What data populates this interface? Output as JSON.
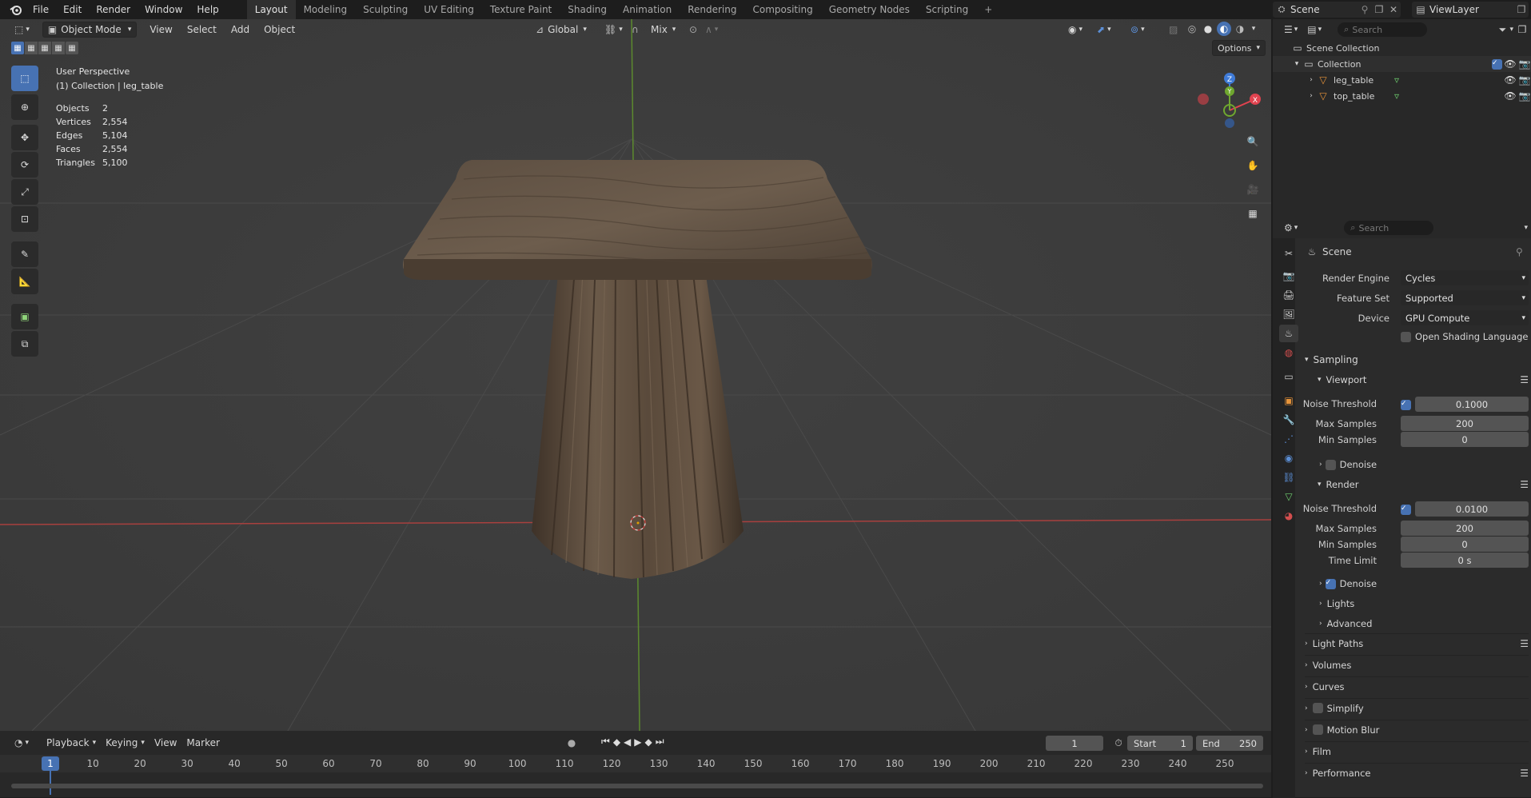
{
  "topbar": {
    "menus": [
      "File",
      "Edit",
      "Render",
      "Window",
      "Help"
    ],
    "workspaces": [
      "Layout",
      "Modeling",
      "Sculpting",
      "UV Editing",
      "Texture Paint",
      "Shading",
      "Animation",
      "Rendering",
      "Compositing",
      "Geometry Nodes",
      "Scripting"
    ],
    "active_workspace": "Layout",
    "scene_name": "Scene",
    "view_layer": "ViewLayer"
  },
  "viewport": {
    "mode": "Object Mode",
    "menus": [
      "View",
      "Select",
      "Add",
      "Object"
    ],
    "orientation": "Global",
    "snap_mix": "Mix",
    "options_label": "Options",
    "overlay_title": "User Perspective",
    "overlay_collection": "(1) Collection | leg_table",
    "stats": [
      {
        "label": "Objects",
        "value": "2"
      },
      {
        "label": "Vertices",
        "value": "2,554"
      },
      {
        "label": "Edges",
        "value": "5,104"
      },
      {
        "label": "Faces",
        "value": "2,554"
      },
      {
        "label": "Triangles",
        "value": "5,100"
      }
    ],
    "gizmo": {
      "x": "X",
      "y": "Y",
      "z": "Z",
      "x_color": "#e0434f",
      "y_color": "#6fa72f",
      "z_color": "#3f7bd8"
    }
  },
  "timeline": {
    "menus": [
      "Playback",
      "Keying",
      "View",
      "Marker"
    ],
    "current_frame": "1",
    "start_label": "Start",
    "start_value": "1",
    "end_label": "End",
    "end_value": "250",
    "ticks": [
      "1",
      "10",
      "20",
      "30",
      "40",
      "50",
      "60",
      "70",
      "80",
      "90",
      "100",
      "110",
      "120",
      "130",
      "140",
      "150",
      "160",
      "170",
      "180",
      "190",
      "200",
      "210",
      "220",
      "230",
      "240",
      "250"
    ]
  },
  "outliner": {
    "search_placeholder": "Search",
    "scene_collection": "Scene Collection",
    "collection": "Collection",
    "objects": [
      "leg_table",
      "top_table"
    ]
  },
  "properties": {
    "search_placeholder": "Search",
    "context": "Scene",
    "render_engine_label": "Render Engine",
    "render_engine": "Cycles",
    "feature_set_label": "Feature Set",
    "feature_set": "Supported",
    "device_label": "Device",
    "device": "GPU Compute",
    "osl_label": "Open Shading Language",
    "sampling": "Sampling",
    "viewport_sub": "Viewport",
    "noise_threshold_label": "Noise Threshold",
    "vp_noise": "0.1000",
    "max_samples_label": "Max Samples",
    "vp_max": "200",
    "min_samples_label": "Min Samples",
    "vp_min": "0",
    "denoise_label": "Denoise",
    "render_sub": "Render",
    "r_noise": "0.0100",
    "r_max": "200",
    "r_min": "0",
    "time_limit_label": "Time Limit",
    "r_time": "0 s",
    "lights": "Lights",
    "advanced": "Advanced",
    "sections": [
      "Light Paths",
      "Volumes",
      "Curves",
      "Simplify",
      "Motion Blur",
      "Film",
      "Performance"
    ]
  },
  "colors": {
    "accent": "#4772b3",
    "viewport_bg": "#3c3c3c",
    "wood": "#5a4a3c"
  }
}
